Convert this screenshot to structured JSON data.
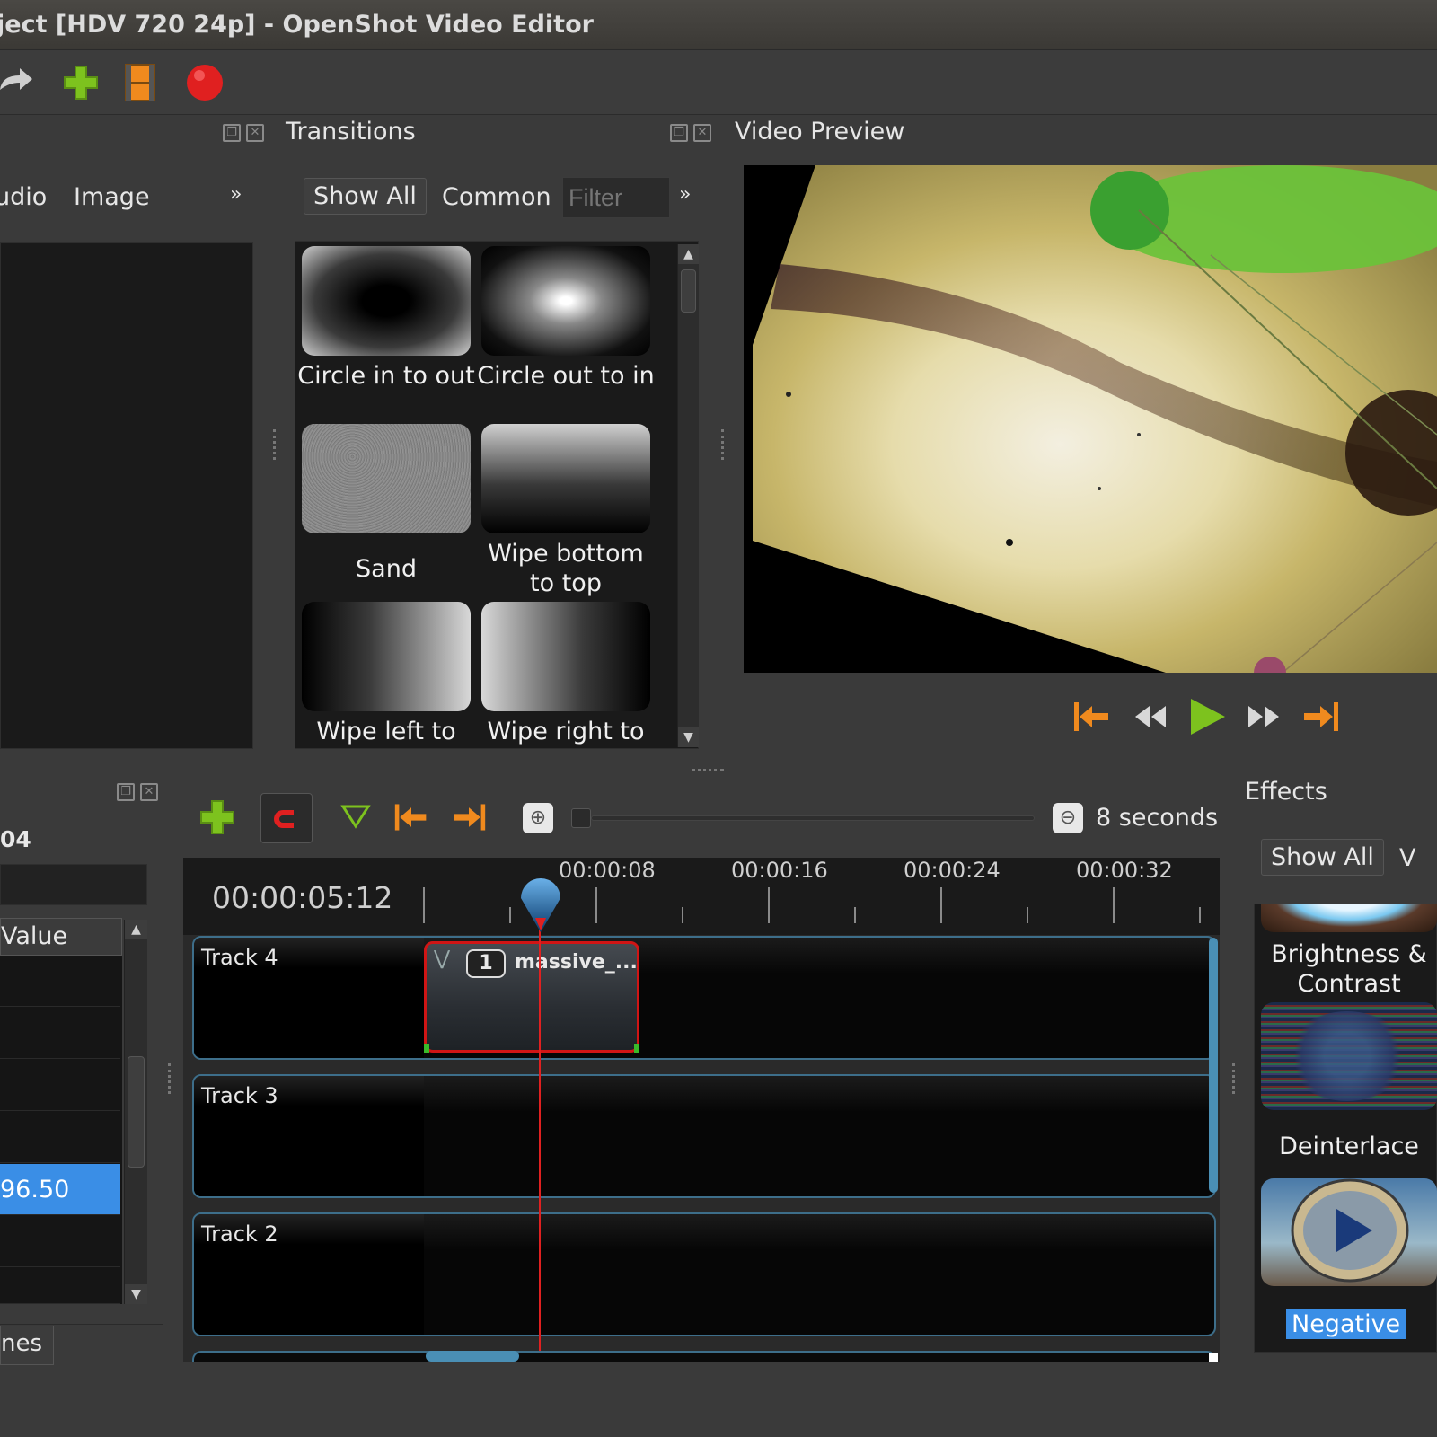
{
  "window": {
    "title": "ject [HDV 720 24p] - OpenShot Video Editor"
  },
  "toolbar": {
    "icons": [
      "redo-icon",
      "add-file-icon",
      "export-film-icon",
      "record-icon"
    ]
  },
  "project_files": {
    "tabs": [
      "udio",
      "Image"
    ],
    "more": "»"
  },
  "transitions": {
    "title": "Transitions",
    "filter_buttons": {
      "show_all": "Show All",
      "common": "Common"
    },
    "filter_placeholder": "Filter",
    "more": "»",
    "items": [
      {
        "label": "Circle in to out"
      },
      {
        "label": "Circle out to in"
      },
      {
        "label": "Sand"
      },
      {
        "label": "Wipe bottom to top"
      },
      {
        "label": "Wipe left to"
      },
      {
        "label": "Wipe right to"
      }
    ]
  },
  "video_preview": {
    "title": "Video Preview"
  },
  "properties": {
    "clip_id": "04",
    "column_header": "Value",
    "selected_value": "96.50",
    "bottom_tab": "nes"
  },
  "timeline": {
    "zoom_label": "8 seconds",
    "current_time": "00:00:05:12",
    "ruler": [
      "00:00:08",
      "00:00:16",
      "00:00:24",
      "00:00:32"
    ],
    "tracks": [
      {
        "name": "Track 4"
      },
      {
        "name": "Track 3"
      },
      {
        "name": "Track 2"
      }
    ],
    "clip": {
      "number": "1",
      "name": "massive_..."
    }
  },
  "effects": {
    "title": "Effects",
    "show_all": "Show All",
    "items": [
      {
        "label": "Brightness & Contrast"
      },
      {
        "label": "Deinterlace"
      },
      {
        "label": "Negative"
      }
    ]
  },
  "colors": {
    "accent_blue": "#3a8ee6",
    "clip_border": "#d01515",
    "playhead": "#e02020",
    "transport_orange": "#f08a1e",
    "transport_green": "#7dc21e"
  }
}
